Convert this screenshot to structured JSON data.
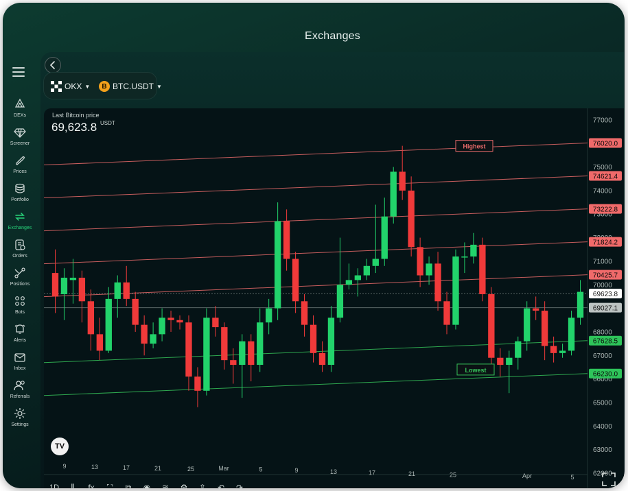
{
  "window": {
    "title": "Exchanges"
  },
  "sidebar": {
    "items": [
      {
        "id": "dexs",
        "label": "DEXs",
        "icon": "dex-icon"
      },
      {
        "id": "screener",
        "label": "Screener",
        "icon": "diamond-icon"
      },
      {
        "id": "prices",
        "label": "Prices",
        "icon": "tag-icon"
      },
      {
        "id": "portfolio",
        "label": "Portfolio",
        "icon": "stack-icon"
      },
      {
        "id": "exchanges",
        "label": "Exchanges",
        "icon": "swap-icon",
        "active": true
      },
      {
        "id": "orders",
        "label": "Orders",
        "icon": "orders-icon"
      },
      {
        "id": "positions",
        "label": "Positions",
        "icon": "positions-icon"
      },
      {
        "id": "bots",
        "label": "Bots",
        "icon": "bots-icon"
      },
      {
        "id": "alerts",
        "label": "Alerts",
        "icon": "bell-icon"
      },
      {
        "id": "inbox",
        "label": "Inbox",
        "icon": "mail-icon"
      },
      {
        "id": "referrals",
        "label": "Referrals",
        "icon": "users-icon"
      },
      {
        "id": "settings",
        "label": "Settings",
        "icon": "gear-icon"
      }
    ]
  },
  "selectors": {
    "exchange": "OKX",
    "pair": "BTC.USDT",
    "pair_icon_glyph": "B"
  },
  "price": {
    "label": "Last Bitcoin price",
    "value": "69,623.8",
    "unit": "USDT"
  },
  "tv_logo_text": "TV",
  "toolbar": {
    "interval": "1D",
    "tools": [
      {
        "name": "candles-icon",
        "glyph": "⫼"
      },
      {
        "name": "indicators-icon",
        "glyph": "fx"
      },
      {
        "name": "crop-icon",
        "glyph": "⛶"
      },
      {
        "name": "templates-icon",
        "glyph": "⧉"
      },
      {
        "name": "eye-icon",
        "glyph": "◉"
      },
      {
        "name": "layers-icon",
        "glyph": "≋"
      },
      {
        "name": "settings-icon",
        "glyph": "⚙"
      },
      {
        "name": "share-icon",
        "glyph": "⇪"
      },
      {
        "name": "undo-icon",
        "glyph": "↶"
      },
      {
        "name": "redo-icon",
        "glyph": "↷"
      }
    ]
  },
  "colors": {
    "up": "#22d36b",
    "down": "#f03a3a",
    "accent": "#27d37a",
    "level_red": "#e86a6a",
    "level_green": "#36c25a",
    "label_red_bg": "#f06a6a",
    "label_green_bg": "#2ec45a"
  },
  "chart_data": {
    "type": "candlestick",
    "title": "",
    "ylim": [
      62000,
      77200
    ],
    "y_ticks": [
      77000,
      76000,
      75000,
      74000,
      73000,
      72000,
      71000,
      70000,
      69000,
      68000,
      67000,
      66000,
      65000,
      64000,
      63000,
      62000
    ],
    "x_ticks": [
      "9",
      "13",
      "17",
      "21",
      "25",
      "Mar",
      "5",
      "9",
      "13",
      "17",
      "21",
      "25",
      "Apr",
      "5"
    ],
    "level_lines": [
      {
        "value": 76020.0,
        "label": "76020.0",
        "color": "red"
      },
      {
        "value": 74621.4,
        "label": "74621.4",
        "color": "red"
      },
      {
        "value": 73222.8,
        "label": "73222.8",
        "color": "red"
      },
      {
        "value": 71824.2,
        "label": "71824.2",
        "color": "red"
      },
      {
        "value": 70425.7,
        "label": "70425.7",
        "color": "red"
      },
      {
        "value": 67628.5,
        "label": "67628.5",
        "color": "green"
      },
      {
        "value": 66230.0,
        "label": "66230.0",
        "color": "green"
      }
    ],
    "current_price": {
      "value": 69623.8,
      "label": "69623.8"
    },
    "previous_close": {
      "value": 69027.1,
      "label": "69027.1"
    },
    "annotations": [
      {
        "text": "Highest",
        "value": 75900
      },
      {
        "text": "Lowest",
        "value": 66400
      }
    ],
    "candles": [
      [
        70500,
        69500,
        71500,
        68800
      ],
      [
        69600,
        70300,
        70700,
        68500
      ],
      [
        70200,
        70300,
        71100,
        69200
      ],
      [
        70300,
        69300,
        70600,
        68400
      ],
      [
        69300,
        67900,
        69800,
        67200
      ],
      [
        67900,
        67200,
        68600,
        66800
      ],
      [
        67200,
        69400,
        69900,
        67100
      ],
      [
        69400,
        70100,
        70400,
        68600
      ],
      [
        70100,
        69400,
        70800,
        69100
      ],
      [
        69400,
        68300,
        69700,
        68000
      ],
      [
        68300,
        67500,
        68700,
        67000
      ],
      [
        67500,
        67900,
        68400,
        67300
      ],
      [
        67900,
        68600,
        69000,
        67600
      ],
      [
        68600,
        68500,
        68900,
        68000
      ],
      [
        68500,
        68400,
        68700,
        68100
      ],
      [
        68400,
        66100,
        68700,
        65500
      ],
      [
        66100,
        65500,
        66500,
        64800
      ],
      [
        65500,
        68600,
        69000,
        65300
      ],
      [
        68600,
        68200,
        69100,
        67800
      ],
      [
        68200,
        66800,
        68400,
        66400
      ],
      [
        66800,
        66600,
        67300,
        65800
      ],
      [
        66600,
        67600,
        67900,
        65200
      ],
      [
        67600,
        66600,
        67900,
        65900
      ],
      [
        66600,
        68400,
        69000,
        66300
      ],
      [
        68400,
        69000,
        69400,
        67900
      ],
      [
        69000,
        72700,
        73500,
        68500
      ],
      [
        72700,
        71100,
        73200,
        70600
      ],
      [
        71100,
        69300,
        71400,
        68800
      ],
      [
        69300,
        68300,
        69600,
        67800
      ],
      [
        68300,
        67100,
        68700,
        66700
      ],
      [
        67100,
        66600,
        67600,
        66300
      ],
      [
        66600,
        68600,
        69100,
        66300
      ],
      [
        68600,
        70000,
        72000,
        68400
      ],
      [
        70000,
        70200,
        70900,
        69800
      ],
      [
        70200,
        70400,
        70700,
        69500
      ],
      [
        70400,
        70800,
        71100,
        70200
      ],
      [
        70800,
        71100,
        73400,
        70500
      ],
      [
        71100,
        72900,
        73700,
        70800
      ],
      [
        72900,
        74800,
        75000,
        72600
      ],
      [
        74800,
        74000,
        75900,
        73600
      ],
      [
        74000,
        71600,
        74600,
        71200
      ],
      [
        71600,
        70400,
        72000,
        69900
      ],
      [
        70400,
        70900,
        71200,
        70000
      ],
      [
        70900,
        69300,
        71400,
        68900
      ],
      [
        69300,
        68300,
        69700,
        67900
      ],
      [
        68300,
        71200,
        71500,
        68100
      ],
      [
        71200,
        71200,
        71800,
        70500
      ],
      [
        71200,
        71700,
        72200,
        70900
      ],
      [
        71700,
        69600,
        72000,
        69300
      ],
      [
        69600,
        66900,
        69900,
        66400
      ],
      [
        66900,
        66600,
        67300,
        66100
      ],
      [
        66600,
        66900,
        67200,
        65400
      ],
      [
        66900,
        67600,
        67800,
        66400
      ],
      [
        67600,
        69000,
        69300,
        67200
      ],
      [
        69000,
        68900,
        69500,
        68500
      ],
      [
        68900,
        67400,
        69300,
        66800
      ],
      [
        67400,
        67100,
        67800,
        66700
      ],
      [
        67100,
        67200,
        67500,
        66900
      ],
      [
        67200,
        68600,
        68900,
        67000
      ],
      [
        68600,
        69700,
        70200,
        68300
      ]
    ]
  }
}
